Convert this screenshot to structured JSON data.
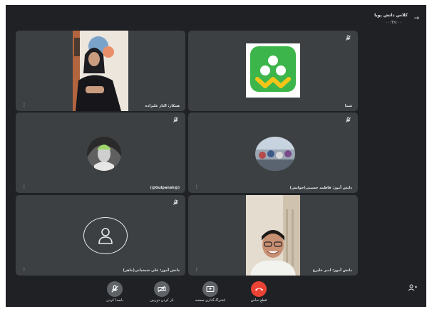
{
  "header": {
    "title": "کلاس دانش پویا",
    "subtitle": "۰۰:۴۸:۰۰"
  },
  "tiles": [
    {
      "name": "همکار: الناز علیزاده"
    },
    {
      "name": "شما"
    },
    {
      "name": "(@Gulpanah@)"
    },
    {
      "name": "دانش آموز: فاطمه حسینی(خوانش)"
    },
    {
      "name": "دانش آموز: علی شیخیانی(ماهر)"
    },
    {
      "name": "دانش آموز: امیر علیرع"
    }
  ],
  "controls": {
    "mic": "باصدا کردن",
    "camera": "باز کردن دوربین",
    "share": "اشتراک‌گذاری صفحه",
    "end": "قطع تماس"
  },
  "colors": {
    "background": "#202124",
    "tile": "#3c4043",
    "end_call": "#ea4335",
    "logo_green": "#3cb54a",
    "logo_yellow": "#f5c518"
  }
}
